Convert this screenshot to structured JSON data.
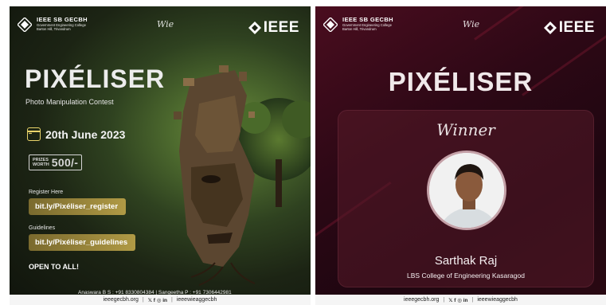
{
  "left_poster": {
    "org_title": "IEEE SB GECBH",
    "org_sub_1": "Government Engineering College",
    "org_sub_2": "Barton Hill, Trivandrum",
    "wie_mark": "Wie",
    "ieee_mark": "IEEE",
    "title": "PIXÉLISER",
    "subtitle": "Photo Manipulation Contest",
    "date": "20th June 2023",
    "prize_label_1": "PRIZES",
    "prize_label_2": "WORTH",
    "prize_amount": "500/-",
    "register_label": "Register Here",
    "register_link": "bit.ly/Pixéliser_register",
    "guidelines_label": "Guidelines",
    "guidelines_link": "bit.ly/Pixéliser_guidelines",
    "open_text": "OPEN TO ALL!",
    "contacts": "Anaswara B S : +91 8330804384 | Sangeetha P : +91 7306442981",
    "footer_site": "ieeegecbh.org",
    "footer_social": "𝕏 f ◎ in",
    "footer_handle": "ieeewieaggecbh"
  },
  "right_poster": {
    "org_title": "IEEE SB GECBH",
    "org_sub_1": "Government Engineering College",
    "org_sub_2": "Barton Hill, Trivandrum",
    "wie_mark": "Wie",
    "ieee_mark": "IEEE",
    "title": "PIXÉLISER",
    "winner_label": "Winner",
    "winner_name": "Sarthak Raj",
    "winner_college": "LBS College of Engineering Kasaragod",
    "footer_site": "ieeegecbh.org",
    "footer_social": "𝕏 f ◎ in",
    "footer_handle": "ieeewieaggecbh"
  },
  "colors": {
    "accent_gold": "#b09a45",
    "right_bg": "#2c0815",
    "left_bg": "#1c2414"
  }
}
